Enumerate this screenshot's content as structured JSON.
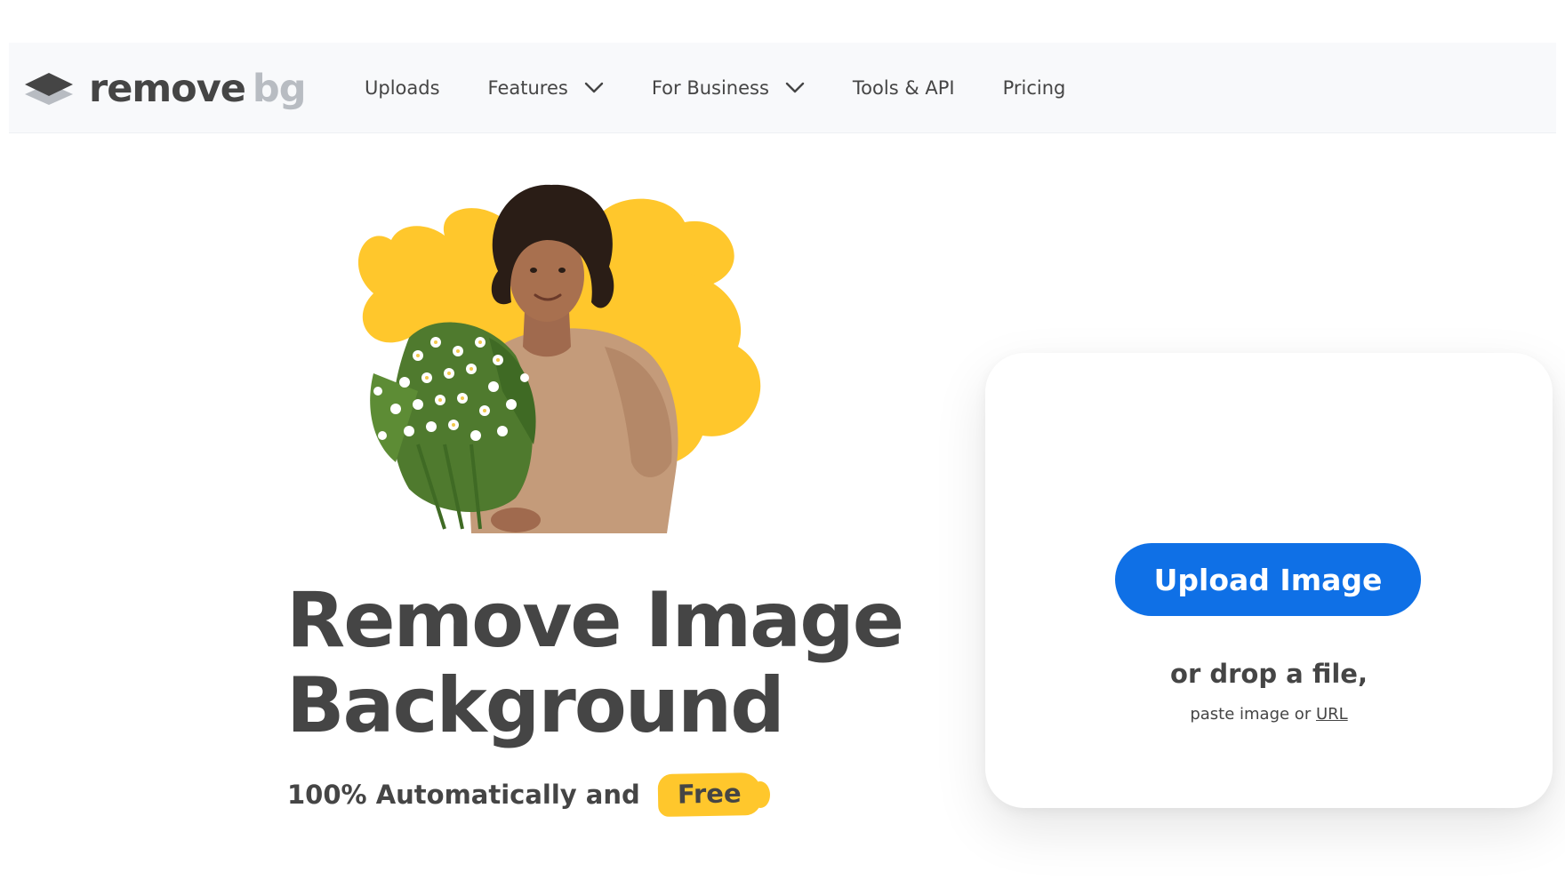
{
  "brand": {
    "logo_word_1": "remove",
    "logo_word_2": "bg",
    "logo_icon": "layers-icon",
    "color_dark": "#454545",
    "color_light": "#b8bcc2"
  },
  "nav": {
    "items": [
      {
        "label": "Uploads",
        "has_dropdown": false
      },
      {
        "label": "Features",
        "has_dropdown": true
      },
      {
        "label": "For Business",
        "has_dropdown": true
      },
      {
        "label": "Tools & API",
        "has_dropdown": false
      },
      {
        "label": "Pricing",
        "has_dropdown": false
      }
    ],
    "dropdown_icon": "chevron-down-icon"
  },
  "hero": {
    "title_line_1": "Remove Image",
    "title_line_2": "Background",
    "subtitle": "100% Automatically and",
    "badge": "Free",
    "badge_color": "#ffc72c",
    "illustration": "woman-holding-flowers-image"
  },
  "upload": {
    "button_label": "Upload Image",
    "button_color": "#0f70e6",
    "drop_text": "or drop a file,",
    "paste_prefix": "paste image or",
    "url_link": "URL"
  }
}
